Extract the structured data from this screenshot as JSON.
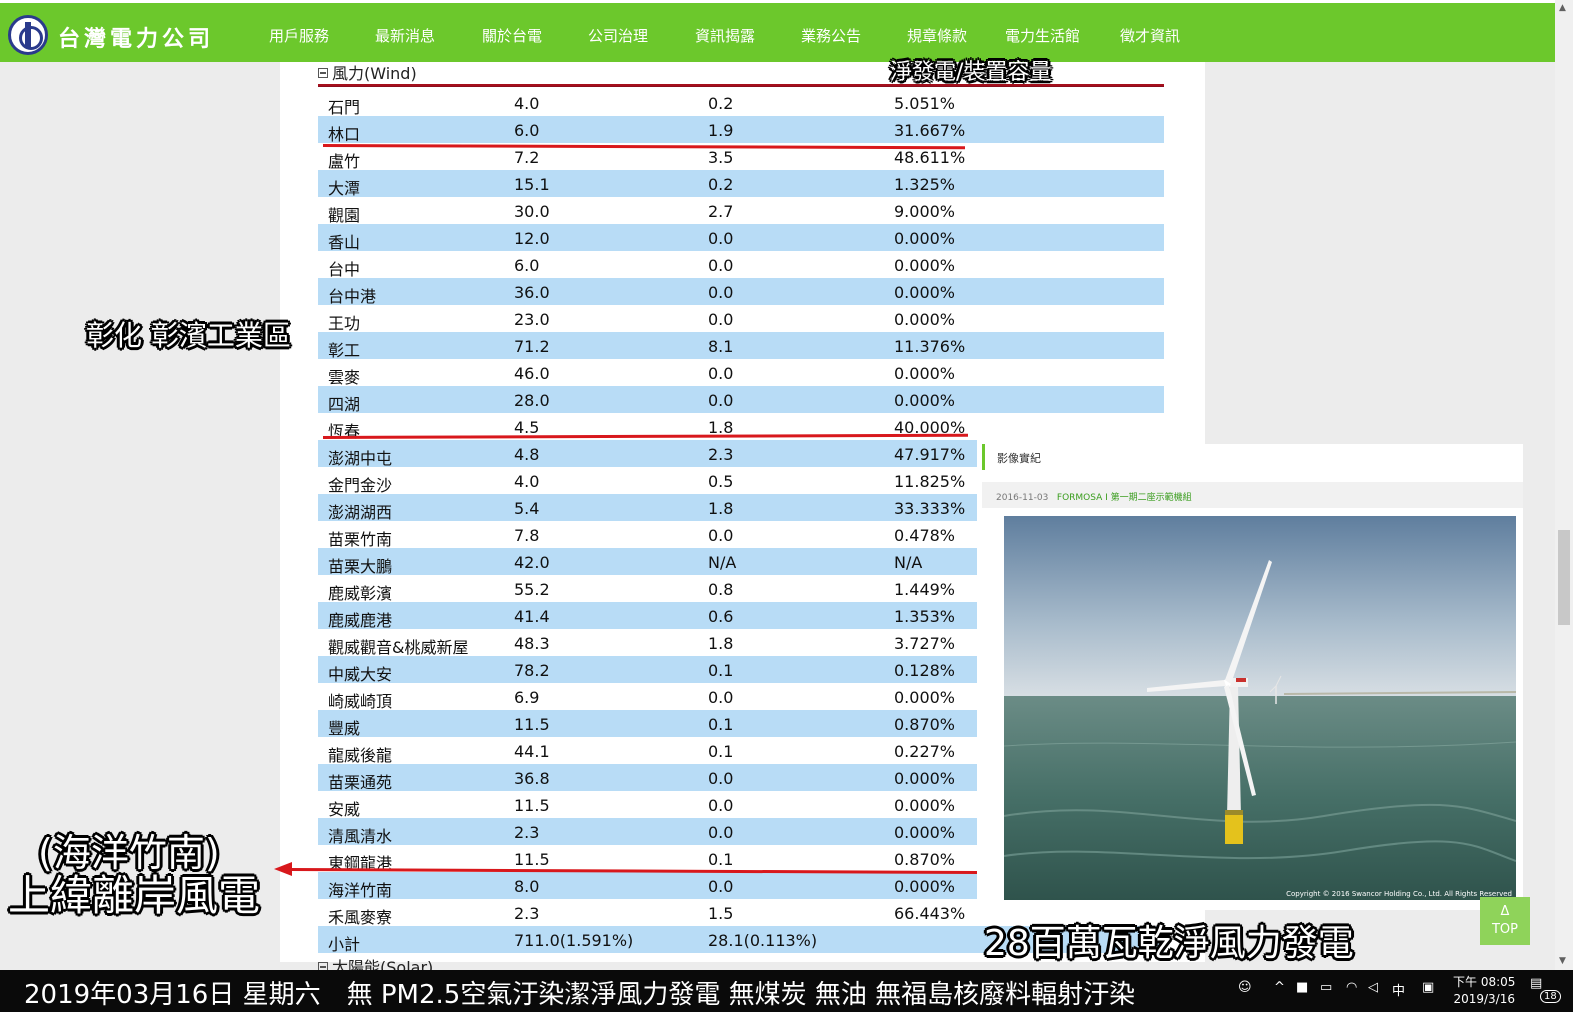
{
  "header": {
    "brand": "台灣電力公司",
    "nav": [
      "用戶服務",
      "最新消息",
      "關於台電",
      "公司治理",
      "資訊揭露",
      "業務公告",
      "規章條款",
      "電力生活館",
      "徵才資訊"
    ]
  },
  "wind_section": {
    "title": "風力(Wind)",
    "rows": [
      [
        "石門",
        "4.0",
        "0.2",
        "5.051%"
      ],
      [
        "林口",
        "6.0",
        "1.9",
        "31.667%"
      ],
      [
        "盧竹",
        "7.2",
        "3.5",
        "48.611%"
      ],
      [
        "大潭",
        "15.1",
        "0.2",
        "1.325%"
      ],
      [
        "觀園",
        "30.0",
        "2.7",
        "9.000%"
      ],
      [
        "香山",
        "12.0",
        "0.0",
        "0.000%"
      ],
      [
        "台中",
        "6.0",
        "0.0",
        "0.000%"
      ],
      [
        "台中港",
        "36.0",
        "0.0",
        "0.000%"
      ],
      [
        "王功",
        "23.0",
        "0.0",
        "0.000%"
      ],
      [
        "彰工",
        "71.2",
        "8.1",
        "11.376%"
      ],
      [
        "雲麥",
        "46.0",
        "0.0",
        "0.000%"
      ],
      [
        "四湖",
        "28.0",
        "0.0",
        "0.000%"
      ],
      [
        "恆春",
        "4.5",
        "1.8",
        "40.000%"
      ],
      [
        "澎湖中屯",
        "4.8",
        "2.3",
        "47.917%"
      ],
      [
        "金門金沙",
        "4.0",
        "0.5",
        "11.825%"
      ],
      [
        "澎湖湖西",
        "5.4",
        "1.8",
        "33.333%"
      ],
      [
        "苗栗竹南",
        "7.8",
        "0.0",
        "0.478%"
      ],
      [
        "苗栗大鵬",
        "42.0",
        "N/A",
        "N/A"
      ],
      [
        "鹿威彰濱",
        "55.2",
        "0.8",
        "1.449%"
      ],
      [
        "鹿威鹿港",
        "41.4",
        "0.6",
        "1.353%"
      ],
      [
        "觀威觀音&桃威新屋",
        "48.3",
        "1.8",
        "3.727%"
      ],
      [
        "中威大安",
        "78.2",
        "0.1",
        "0.128%"
      ],
      [
        "崎威崎頂",
        "6.9",
        "0.0",
        "0.000%"
      ],
      [
        "豐威",
        "11.5",
        "0.1",
        "0.870%"
      ],
      [
        "龍威後龍",
        "44.1",
        "0.1",
        "0.227%"
      ],
      [
        "苗栗通苑",
        "36.8",
        "0.0",
        "0.000%"
      ],
      [
        "安威",
        "11.5",
        "0.0",
        "0.000%"
      ],
      [
        "清風清水",
        "2.3",
        "0.0",
        "0.000%"
      ],
      [
        "東鋼龍港",
        "11.5",
        "0.1",
        "0.870%"
      ],
      [
        "海洋竹南",
        "8.0",
        "0.0",
        "0.000%"
      ],
      [
        "禾風麥寮",
        "2.3",
        "1.5",
        "66.443%"
      ],
      [
        "小計",
        "711.0(1.591%)",
        "28.1(0.113%)",
        ""
      ]
    ]
  },
  "solar_section": {
    "title": "太陽能(Solar)"
  },
  "annotations": {
    "ratio_label": "淨發電/裝置容量",
    "changhua": "彰化 彰濱工業區",
    "offshore_line1": "(海洋竹南)",
    "offshore_line2": "上緯離岸風電",
    "capacity_note": "28百萬瓦乾淨風力發電"
  },
  "photo_panel": {
    "heading": "影像實紀",
    "date": "2016-11-03",
    "caption": "FORMOSA I 第一期二座示範機組",
    "copyright": "Copyright © 2016 Swancor Holding Co., Ltd. All Rights Reserved"
  },
  "top_button": {
    "arrow": "Δ",
    "label": "TOP"
  },
  "taskbar": {
    "ticker": "2019年03月16日 星期六　無 PM2.5空氣汙染潔淨風力發電 無煤炭 無油 無福島核廢料輻射汙染",
    "ime": "中",
    "time": "下午 08:05",
    "date": "2019/3/16",
    "notifications": "18"
  },
  "colors": {
    "nav_green": "#6cc82c",
    "row_blue": "#b8dcf6",
    "header_line": "#8b0d1e",
    "annotation_red": "#d8181c"
  }
}
